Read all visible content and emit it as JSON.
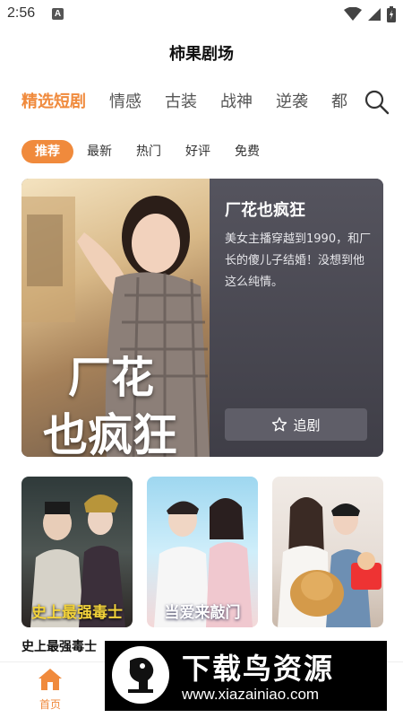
{
  "status_bar": {
    "time": "2:56",
    "notification_badge": "A",
    "icons": [
      "wifi-icon",
      "signal-icon",
      "battery-icon"
    ]
  },
  "header": {
    "title": "柿果剧场"
  },
  "category_tabs": [
    {
      "label": "精选短剧",
      "active": true
    },
    {
      "label": "情感"
    },
    {
      "label": "古装"
    },
    {
      "label": "战神"
    },
    {
      "label": "逆袭"
    },
    {
      "label": "都"
    }
  ],
  "filter_chips": [
    {
      "label": "推荐",
      "active": true
    },
    {
      "label": "最新"
    },
    {
      "label": "热门"
    },
    {
      "label": "好评"
    },
    {
      "label": "免费"
    }
  ],
  "featured": {
    "title": "厂花也疯狂",
    "description": "美女主播穿越到1990，和厂长的傻儿子结婚！没想到他这么纯情。",
    "follow_label": "追剧",
    "poster_text_line1": "厂花",
    "poster_text_line2": "也疯狂"
  },
  "grid": {
    "cards": [
      {
        "poster_text": "史上最强毒士",
        "accent": "#f2d23a"
      },
      {
        "poster_text": "当爱来敲门",
        "accent": "#ffffff"
      },
      {
        "poster_text": "",
        "accent": "#e33"
      }
    ],
    "first_label": "史上最强毒士"
  },
  "bottom_nav": {
    "home_label": "首页",
    "accent": "#f08a3c"
  },
  "watermark": {
    "text": "下载鸟资源",
    "url": "www.xiazainiao.com"
  },
  "colors": {
    "accent": "#f08a3c",
    "featured_bg": "#4a4a55"
  }
}
